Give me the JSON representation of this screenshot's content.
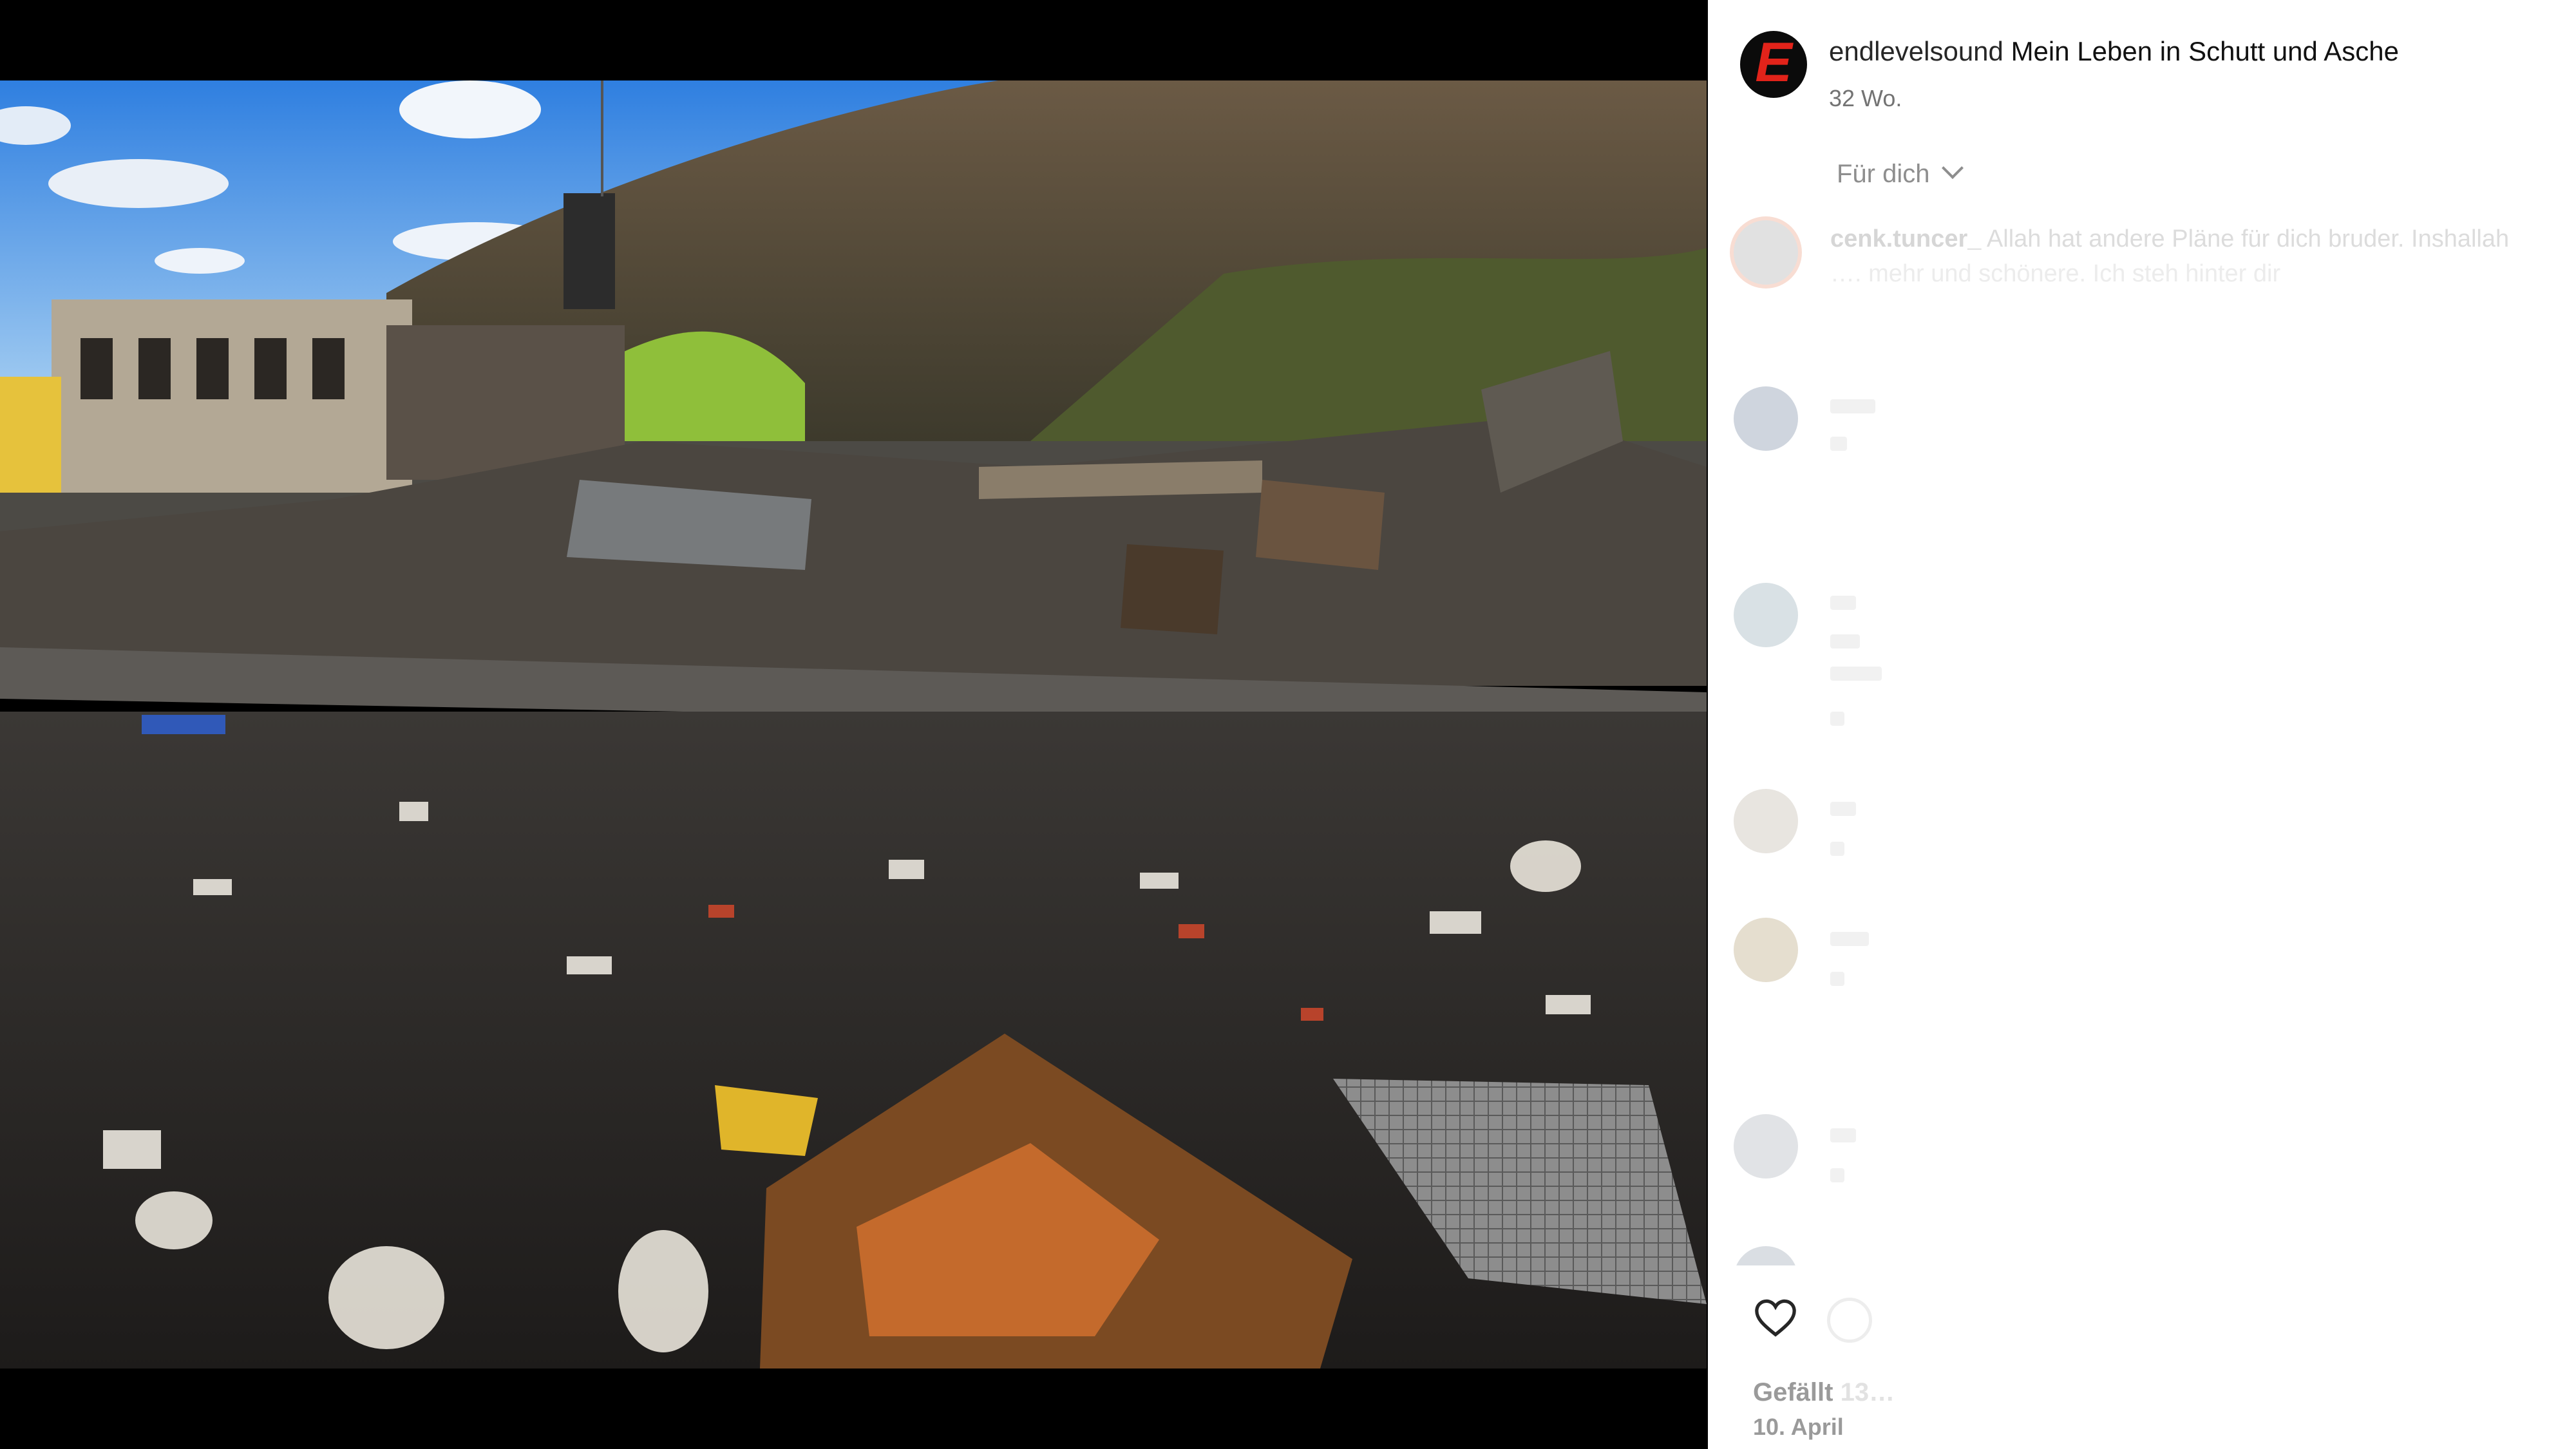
{
  "post": {
    "username": "endlevelsound",
    "caption": "Mein Leben in Schutt und Asche",
    "time": "32 Wo.",
    "logo_letter": "E"
  },
  "filter": {
    "label": "Für dich"
  },
  "comments": [
    {
      "user": "cenk.tuncer_",
      "text": "Allah hat andere Pläne für dich bruder. Inshallah",
      "sub": "…. mehr und schönere. Ich steh hinter dir"
    },
    {
      "user": "",
      "text": ""
    },
    {
      "user": "",
      "text": ""
    },
    {
      "user": "",
      "text": ""
    },
    {
      "user": "",
      "text": ""
    },
    {
      "user": "",
      "text": ""
    },
    {
      "user": "",
      "text": ""
    }
  ],
  "footer": {
    "likes_label": "Gefällt",
    "likes_count": "13…",
    "date_label": "10. April"
  },
  "colors": {
    "brand": "#e2231a",
    "logo_bg": "#0b0b0b"
  },
  "icons": [
    "heart-icon",
    "comment-icon",
    "chevron-down-icon"
  ]
}
